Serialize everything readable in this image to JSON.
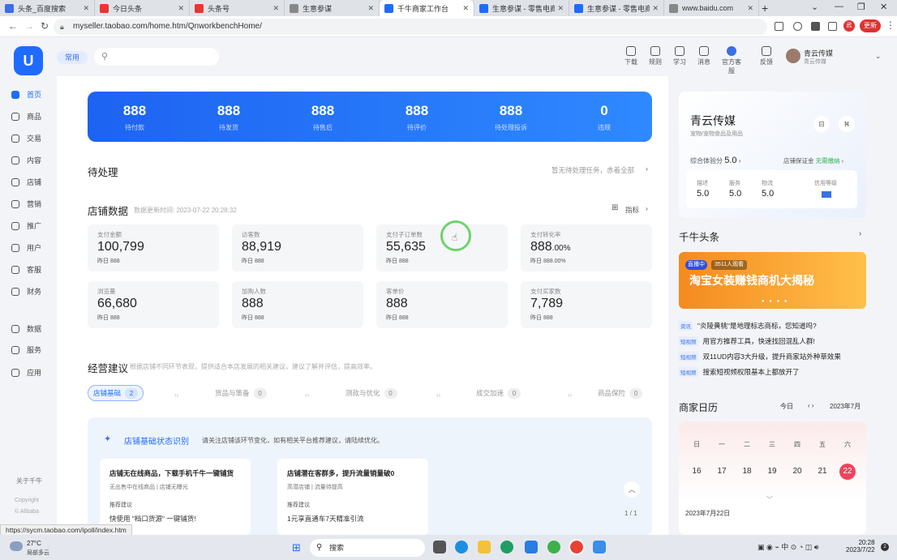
{
  "browser": {
    "tabs": [
      {
        "title": "头条_百度搜索",
        "favicon": "#3a6fe8",
        "active": false
      },
      {
        "title": "今日头条",
        "favicon": "#e33",
        "active": false
      },
      {
        "title": "头条号",
        "favicon": "#e33",
        "active": false
      },
      {
        "title": "生意参谋",
        "favicon": "#888",
        "active": false
      },
      {
        "title": "千牛商家工作台",
        "favicon": "#1f6bff",
        "active": true
      },
      {
        "title": "生意参谋 - 零售电商",
        "favicon": "#1f6bff",
        "active": false
      },
      {
        "title": "生意参谋 - 零售电商",
        "favicon": "#1f6bff",
        "active": false
      },
      {
        "title": "www.baidu.com",
        "favicon": "#888",
        "active": false
      }
    ],
    "new_tab": "+",
    "url": "myseller.taobao.com/home.htm/QnworkbenchHome/",
    "profile_initial": "武",
    "update_label": "更新"
  },
  "header": {
    "logo_glyph": "U",
    "common_label": "常用",
    "search_placeholder": "",
    "icons": [
      {
        "label": "下载",
        "icon": "download-icon"
      },
      {
        "label": "规则",
        "icon": "rules-icon"
      },
      {
        "label": "学习",
        "icon": "study-icon"
      },
      {
        "label": "消息",
        "icon": "message-icon"
      },
      {
        "label": "官方客服",
        "icon": "service-icon"
      },
      {
        "label": "反馈",
        "icon": "feedback-icon"
      }
    ],
    "user_name": "青云传媒",
    "user_sub": "青云传媒"
  },
  "sidebar": {
    "items": [
      {
        "label": "首页",
        "active": true
      },
      {
        "label": "商品"
      },
      {
        "label": "交易"
      },
      {
        "label": "内容"
      },
      {
        "label": "店铺"
      },
      {
        "label": "营销"
      },
      {
        "label": "推广"
      },
      {
        "label": "用户"
      },
      {
        "label": "客服"
      },
      {
        "label": "财务"
      },
      {
        "label": "数据"
      },
      {
        "label": "服务"
      },
      {
        "label": "应用"
      }
    ],
    "about": "关于千牛",
    "copyright1": "Copyright",
    "copyright2": "© Alibaba"
  },
  "todo_stats": [
    {
      "value": "888",
      "label": "待付款"
    },
    {
      "value": "888",
      "label": "待发货"
    },
    {
      "value": "888",
      "label": "待售后"
    },
    {
      "value": "888",
      "label": "待评价"
    },
    {
      "value": "888",
      "label": "待处理投诉"
    },
    {
      "value": "0",
      "label": "违规"
    }
  ],
  "pending": {
    "title": "待处理",
    "note": "暂无待处理任务，赤着全部"
  },
  "shop_data": {
    "title": "店铺数据",
    "updated": "数据更新时间: 2023-07-22 20:28:32",
    "metric_btn": "指标",
    "cards": [
      {
        "title": "支付金额",
        "value": "100,799",
        "unit": "",
        "yesterday": "昨日 888"
      },
      {
        "title": "访客数",
        "value": "88,919",
        "unit": "",
        "yesterday": "昨日 888"
      },
      {
        "title": "支付子订单数",
        "value": "55,635",
        "unit": "",
        "yesterday": "昨日 888"
      },
      {
        "title": "支付转化率",
        "value": "888",
        "unit": ".00%",
        "yesterday": "昨日 888.00%"
      },
      {
        "title": "浏览量",
        "value": "66,680",
        "unit": "",
        "yesterday": "昨日 888"
      },
      {
        "title": "加购人数",
        "value": "888",
        "unit": "",
        "yesterday": "昨日 888"
      },
      {
        "title": "客单价",
        "value": "888",
        "unit": "",
        "yesterday": "昨日 888"
      },
      {
        "title": "支付买家数",
        "value": "7,789",
        "unit": "",
        "yesterday": "昨日 888"
      }
    ]
  },
  "advice": {
    "title": "经营建议",
    "note": "根据店铺不同环节表现，提供适合本店发展的相关建议，建议了解并评估，提高效率。",
    "tabs": [
      {
        "label": "店铺基础",
        "count": "2",
        "active": true
      },
      {
        "label": "货品与策备",
        "count": "0"
      },
      {
        "label": "测款与优化",
        "count": "0"
      },
      {
        "label": "成交加速",
        "count": "0"
      },
      {
        "label": "商品保险",
        "count": "0"
      }
    ],
    "box_title": "店铺基础状态识别",
    "box_desc": "请关注店铺该环节变化，如有相关平台推荐建议，请陆续优化。",
    "cards": [
      {
        "head": "店铺无在线商品，下载手机千牛一键铺货",
        "sub": "无出售中在线商品 | 店铺无曝光",
        "kicker": "推荐建议",
        "detail": "快使用 \"档口货源\" 一键铺货!"
      },
      {
        "head": "店铺潜在客群多，提升流量销量破0",
        "sub": "高潜店铺 | 流量待提高",
        "kicker": "推荐建议",
        "detail": "1元享直通车7天精准引流"
      }
    ],
    "pager": "1 / 1"
  },
  "right": {
    "shop_name": "青云传媒",
    "shop_sub": "宠物/宠物食品及用品",
    "score_label": "综合体验分",
    "score": "5.0",
    "deposit_label": "店铺保证金",
    "deposit_value": "无需缴纳",
    "dsr": [
      {
        "label": "描述",
        "value": "5.0"
      },
      {
        "label": "服务",
        "value": "5.0"
      },
      {
        "label": "物流",
        "value": "5.0"
      },
      {
        "label": "信用等级",
        "value": ""
      }
    ],
    "news_title": "千牛头条",
    "banner": {
      "live": "直播中",
      "viewers": "3511人观看",
      "title": "淘宝女装赚钱商机大揭秘"
    },
    "news": [
      {
        "tag": "资讯",
        "text": "\"炎陵黄桃\"是地理标志商标，您知道吗?"
      },
      {
        "tag": "短视频",
        "text": "用官方推荐工具，快速找回混乱人群!"
      },
      {
        "tag": "短视频",
        "text": "双11UD内容3大升级，提升商家站外种草效果"
      },
      {
        "tag": "短视频",
        "text": "搜索短视频权限基本上都放开了"
      }
    ],
    "calendar": {
      "title": "商家日历",
      "today": "今日",
      "month": "2023年7月",
      "weekdays": [
        "日",
        "一",
        "二",
        "三",
        "四",
        "五",
        "六"
      ],
      "days": [
        "16",
        "17",
        "18",
        "19",
        "20",
        "21",
        "22"
      ],
      "selected": "22",
      "selected_date": "2023年7月22日"
    }
  },
  "status_url": "https://sycm.taobao.com/ipoll/index.htm",
  "taskbar": {
    "temp": "27°C",
    "weather": "局部多云",
    "search": "搜索",
    "tray": "中",
    "time": "20:28",
    "date": "2023/7/22",
    "notif": "2"
  }
}
